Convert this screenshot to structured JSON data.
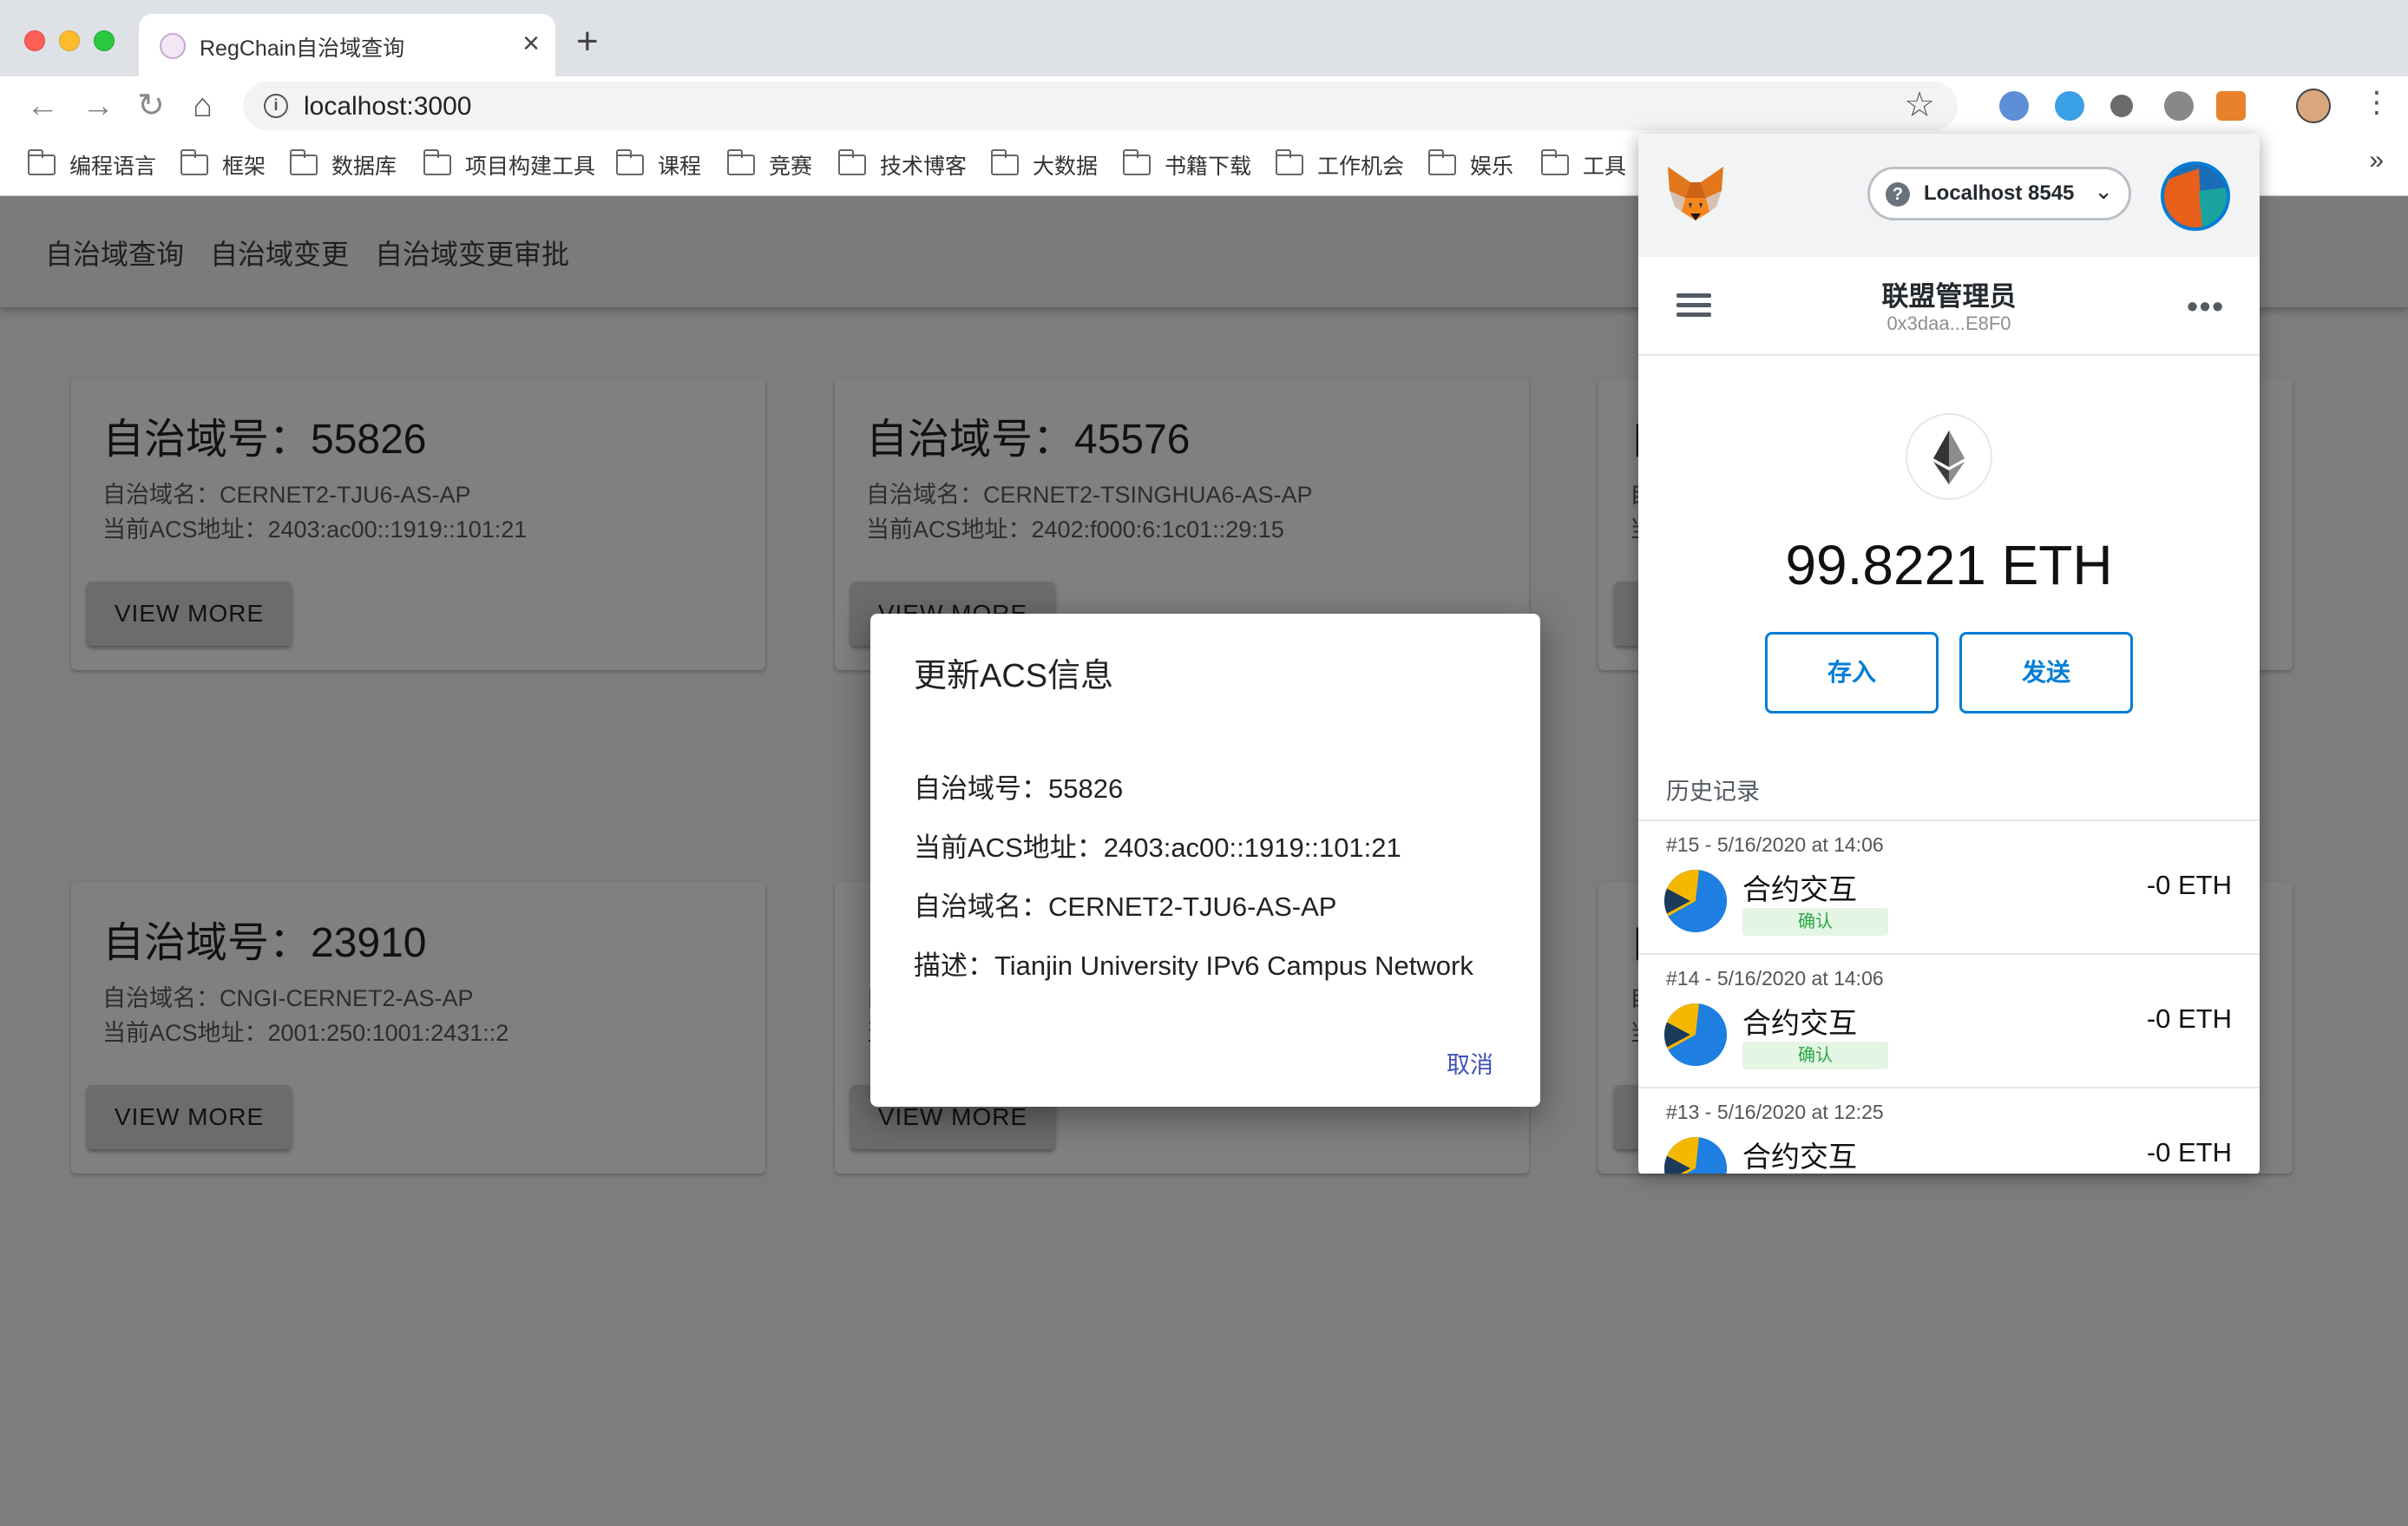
{
  "browser": {
    "tab_title": "RegChain自治域查询",
    "url": "localhost:3000",
    "bookmarks": [
      "编程语言",
      "框架",
      "数据库",
      "项目构建工具",
      "课程",
      "竞赛",
      "技术博客",
      "大数据",
      "书籍下载",
      "工作机会",
      "娱乐",
      "工具"
    ],
    "bookmarks_more": "»"
  },
  "appbar": {
    "links": [
      "自治域查询",
      "自治域变更",
      "自治域变更审批"
    ]
  },
  "cards": [
    {
      "title": "自治域号：55826",
      "name": "自治域名：CERNET2-TJU6-AS-AP",
      "acs": "当前ACS地址：2403:ac00::1919::101:21",
      "button": "VIEW MORE"
    },
    {
      "title": "自治域号：45576",
      "name": "自治域名：CERNET2-TSINGHUA6-AS-AP",
      "acs": "当前ACS地址：2402:f000:6:1c01::29:15",
      "button": "VIEW MORE"
    },
    {
      "title": "自",
      "name": "自",
      "acs": "当",
      "button": ""
    },
    {
      "title": "自治域号：23910",
      "name": "自治域名：CNGI-CERNET2-AS-AP",
      "acs": "当前ACS地址：2001:250:1001:2431::2",
      "button": "VIEW MORE"
    },
    {
      "title": "",
      "name": "自",
      "acs": "当",
      "button": "VIEW MORE"
    },
    {
      "title": "自",
      "name": "自",
      "acs": "当",
      "button": ""
    }
  ],
  "dialog": {
    "title": "更新ACS信息",
    "rows": [
      "自治域号：55826",
      "当前ACS地址：2403:ac00::1919::101:21",
      "自治域名：CERNET2-TJU6-AS-AP",
      "描述：Tianjin University IPv6 Campus Network"
    ],
    "cancel": "取消",
    "accent_color": "#3f51b5"
  },
  "metamask": {
    "network": "Localhost 8545",
    "account_name": "联盟管理员",
    "account_address": "0x3daa...E8F0",
    "balance": "99.8221 ETH",
    "deposit_label": "存入",
    "send_label": "发送",
    "history_label": "历史记录",
    "accent_color": "#037dd6",
    "transactions": [
      {
        "date": "#15 - 5/16/2020 at 14:06",
        "type": "合约交互",
        "status": "确认",
        "amount": "-0 ETH"
      },
      {
        "date": "#14 - 5/16/2020 at 14:06",
        "type": "合约交互",
        "status": "确认",
        "amount": "-0 ETH"
      },
      {
        "date": "#13 - 5/16/2020 at 12:25",
        "type": "合约交互",
        "status": "",
        "amount": "-0 ETH"
      }
    ]
  }
}
